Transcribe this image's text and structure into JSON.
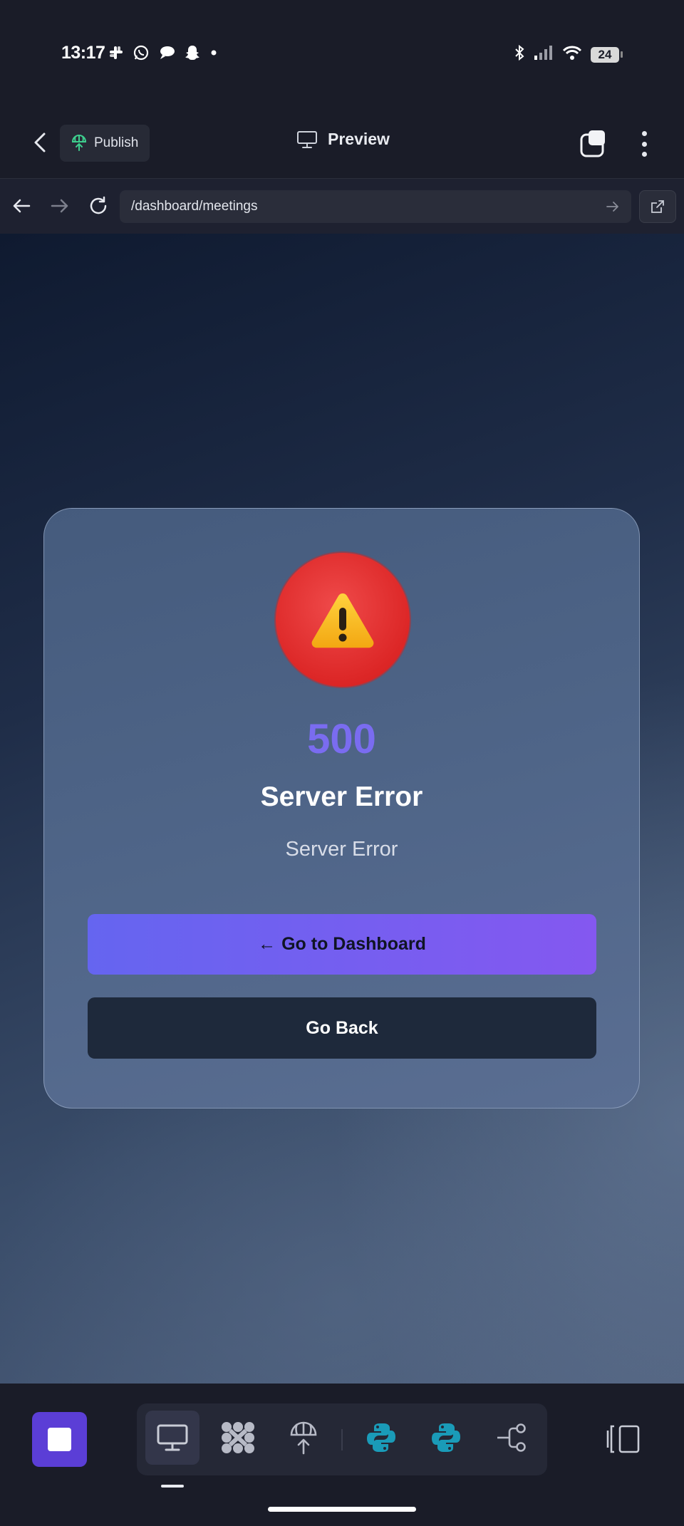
{
  "status_bar": {
    "time": "13:17",
    "left_icons": [
      "slack-icon",
      "whatsapp-icon",
      "chat-bubbles-icon",
      "snapchat-icon",
      "dot-icon"
    ],
    "right_icons": [
      "bluetooth-icon",
      "signal-icon",
      "wifi-icon"
    ],
    "battery": "24"
  },
  "header": {
    "publish_label": "Publish",
    "title": "Preview"
  },
  "url_bar": {
    "path": "/dashboard/meetings"
  },
  "error_card": {
    "icon": "warning-icon",
    "code": "500",
    "title": "Server Error",
    "message": "Server Error",
    "primary_button": {
      "arrow": "←",
      "label": "Go to Dashboard"
    },
    "secondary_button": {
      "label": "Go Back"
    }
  },
  "bottom_toolbar": {
    "tools": [
      "monitor-icon",
      "nodes-icon",
      "publish-icon",
      "python-icon",
      "python-icon",
      "flow-icon"
    ],
    "active_tool": "monitor-icon"
  },
  "colors": {
    "accent": "#7a6cf0",
    "button_gradient_start": "#6565f0",
    "button_gradient_end": "#8458f0",
    "error_red": "#dc2626",
    "dark_button": "#1e293b",
    "stop_button": "#5b3ed6",
    "python_teal": "#1a9bb8"
  }
}
